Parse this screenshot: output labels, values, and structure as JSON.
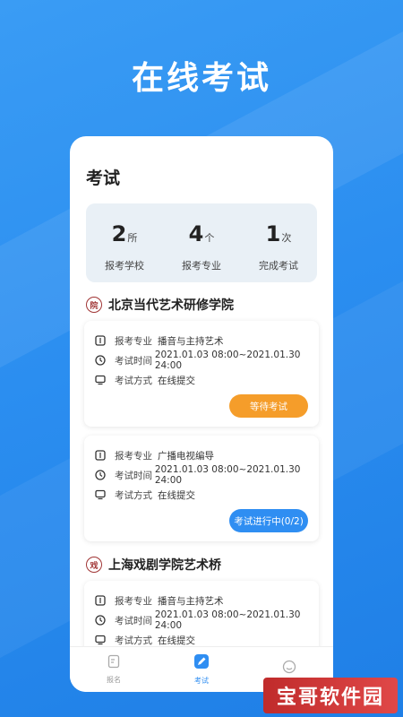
{
  "promo_title": "在线考试",
  "screen": {
    "title": "考试",
    "stats": [
      {
        "num": "2",
        "unit": "所",
        "label": "报考学校"
      },
      {
        "num": "4",
        "unit": "个",
        "label": "报考专业"
      },
      {
        "num": "1",
        "unit": "次",
        "label": "完成考试"
      }
    ],
    "schools": [
      {
        "name": "北京当代艺术研修学院",
        "logo_text": "院",
        "exams": [
          {
            "major_label": "报考专业",
            "major": "播音与主持艺术",
            "time_label": "考试时间",
            "time": "2021.01.03 08:00~2021.01.30 24:00",
            "method_label": "考试方式",
            "method": "在线提交",
            "button": "等待考试",
            "button_color": "#f59d2a"
          },
          {
            "major_label": "报考专业",
            "major": "广播电视编导",
            "time_label": "考试时间",
            "time": "2021.01.03 08:00~2021.01.30 24:00",
            "method_label": "考试方式",
            "method": "在线提交",
            "button": "考试进行中(0/2)",
            "button_color": "#2f8ef2"
          }
        ]
      },
      {
        "name": "上海戏剧学院艺术桥",
        "logo_text": "戏",
        "exams": [
          {
            "major_label": "报考专业",
            "major": "播音与主持艺术",
            "time_label": "考试时间",
            "time": "2021.01.03 08:00~2021.01.30 24:00",
            "method_label": "考试方式",
            "method": "在线提交"
          }
        ]
      }
    ],
    "tabbar": [
      {
        "label": "报名",
        "icon": "form-icon"
      },
      {
        "label": "考试",
        "icon": "pen-icon",
        "active": true
      },
      {
        "label": "",
        "icon": "smile-icon"
      }
    ]
  },
  "watermark": "宝哥软件园",
  "colors": {
    "background": "#2b8ef0",
    "accent": "#2f8ef2",
    "orange": "#f59d2a"
  }
}
